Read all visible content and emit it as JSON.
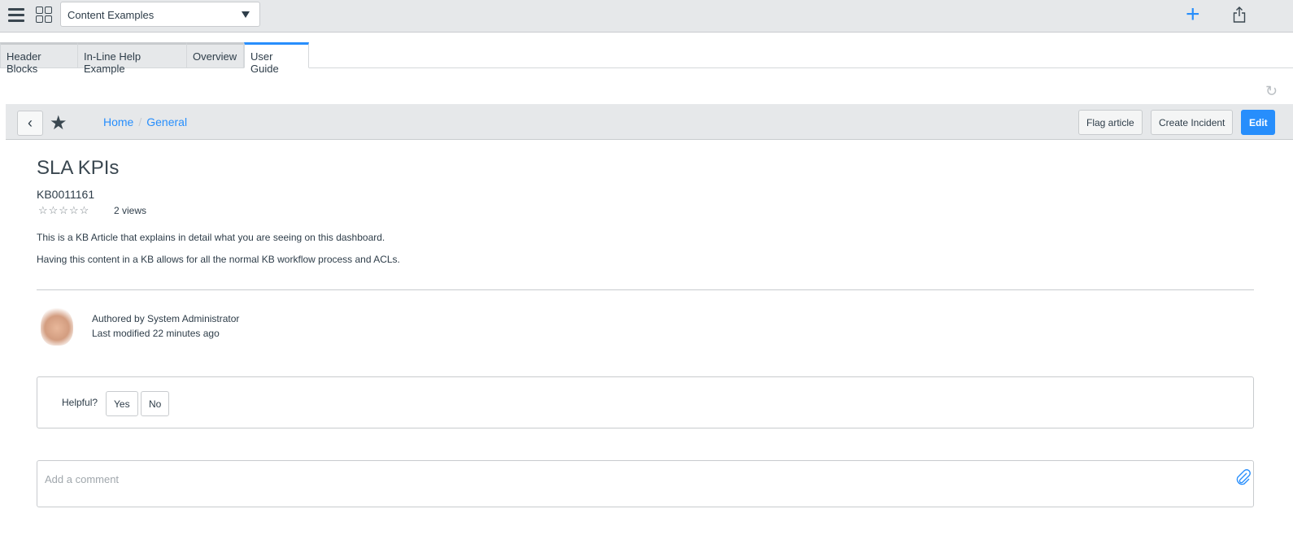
{
  "topbar": {
    "selector_value": "Content Examples"
  },
  "tabs": [
    "Header Blocks",
    "In-Line Help Example",
    "Overview",
    "User Guide"
  ],
  "breadcrumb": {
    "home": "Home",
    "separator": "/",
    "current": "General"
  },
  "actions": {
    "flag": "Flag article",
    "create_incident": "Create Incident",
    "edit": "Edit"
  },
  "article": {
    "title": "SLA KPIs",
    "number": "KB0011161",
    "rating_stars": "☆☆☆☆☆",
    "rating": 0,
    "views": "2 views",
    "paragraphs": [
      "This is a KB Article that explains in detail what you are seeing on this dashboard.",
      "Having this content in a KB allows for all the normal KB workflow process and ACLs."
    ],
    "authored_by": "Authored by System Administrator",
    "last_modified": "Last modified 22 minutes ago"
  },
  "feedback": {
    "label": "Helpful?",
    "yes": "Yes",
    "no": "No"
  },
  "comment": {
    "placeholder": "Add a comment"
  },
  "colors": {
    "accent": "#278efc",
    "bar": "#e6e8ea"
  }
}
